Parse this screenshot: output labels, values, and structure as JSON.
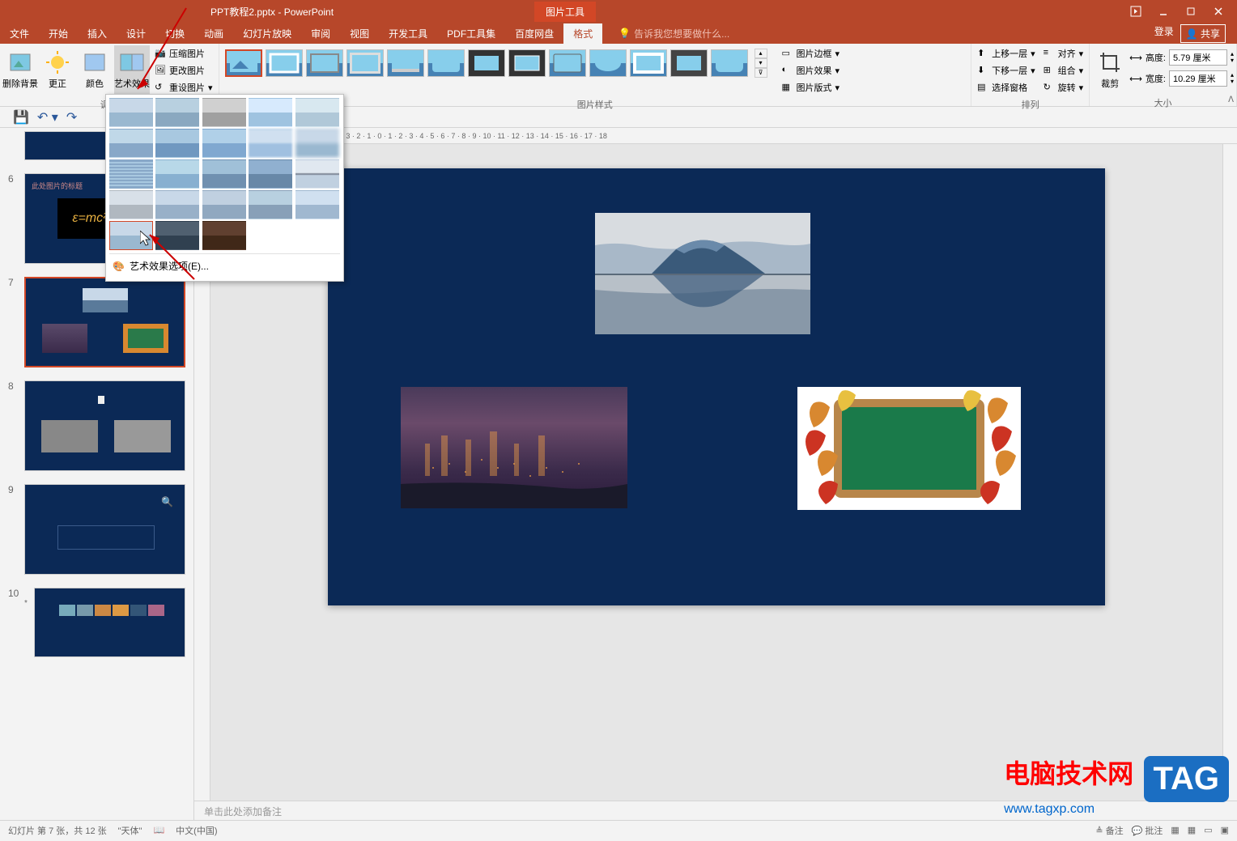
{
  "titlebar": {
    "title": "PPT教程2.pptx - PowerPoint",
    "picture_tools": "图片工具"
  },
  "tabs": {
    "file": "文件",
    "home": "开始",
    "insert": "插入",
    "design": "设计",
    "transitions": "切换",
    "animations": "动画",
    "slideshow": "幻灯片放映",
    "review": "审阅",
    "view": "视图",
    "developer": "开发工具",
    "pdf": "PDF工具集",
    "baidu": "百度网盘",
    "format": "格式",
    "tellme": "告诉我您想要做什么...",
    "login": "登录",
    "share": "共享"
  },
  "ribbon": {
    "remove_bg": "删除背景",
    "corrections": "更正",
    "color": "颜色",
    "artistic": "艺术效果",
    "compress": "压缩图片",
    "change": "更改图片",
    "reset": "重设图片",
    "adjust_group": "调整",
    "styles_group": "图片样式",
    "border": "图片边框",
    "effects": "图片效果",
    "layout": "图片版式",
    "forward": "上移一层",
    "backward": "下移一层",
    "selection": "选择窗格",
    "align": "对齐",
    "group": "组合",
    "rotate": "旋转",
    "arrange_group": "排列",
    "crop": "裁剪",
    "height_label": "高度:",
    "height_val": "5.79 厘米",
    "width_label": "宽度:",
    "width_val": "10.29 厘米",
    "size_group": "大小"
  },
  "artistic_options": "艺术效果选项(E)...",
  "slides": [
    {
      "num": "6",
      "caption": "此处图片的标题"
    },
    {
      "num": "7"
    },
    {
      "num": "8"
    },
    {
      "num": "9"
    },
    {
      "num": "10"
    }
  ],
  "notes_placeholder": "单击此处添加备注",
  "statusbar": {
    "slide_info": "幻灯片 第 7 张，共 12 张",
    "theme": "\"天体\"",
    "language": "中文(中国)",
    "notes": "备注",
    "comments": "批注"
  },
  "ruler_marks": "14 · 13 · 12 · 11 · 10 · 9 · 8 · 7 · 6 · 5 · 4 · 3 · 2 · 1 · 0 · 1 · 2 · 3 · 4 · 5 · 6 · 7 · 8 · 9 · 10 · 11 · 12 · 13 · 14 · 15 · 16 · 17 · 18",
  "watermark": {
    "title": "电脑技术网",
    "url": "www.tagxp.com",
    "tag": "TAG"
  }
}
